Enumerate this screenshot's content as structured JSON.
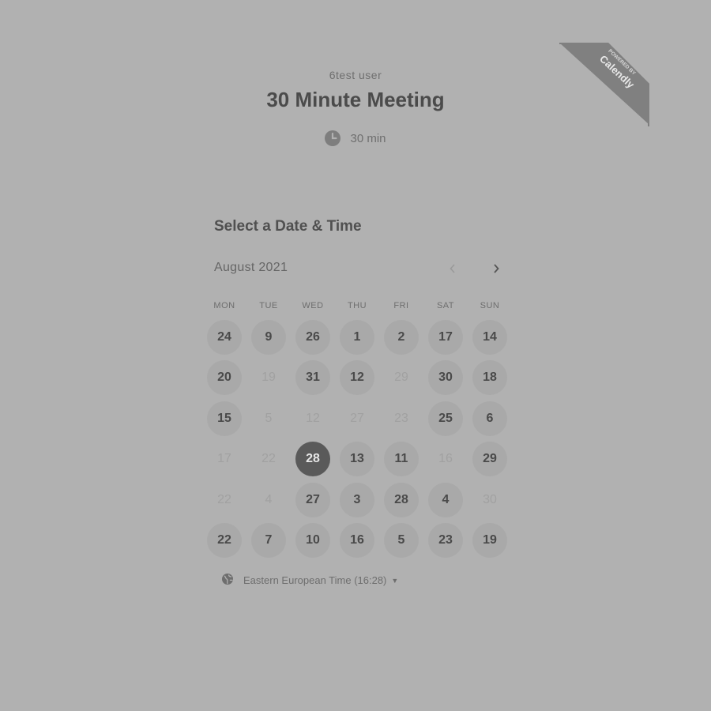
{
  "event": {
    "owner": "6test user",
    "title": "30 Minute Meeting",
    "duration": "30 min"
  },
  "badge": {
    "line1": "POWERED BY",
    "line2": "Calendly"
  },
  "calendar": {
    "heading": "Select a Date & Time",
    "month": "August 2021",
    "weekdays": [
      "MON",
      "TUE",
      "WED",
      "THU",
      "FRI",
      "SAT",
      "SUN"
    ],
    "days": [
      {
        "label": "24",
        "state": "available"
      },
      {
        "label": "9",
        "state": "available"
      },
      {
        "label": "26",
        "state": "available"
      },
      {
        "label": "1",
        "state": "available"
      },
      {
        "label": "2",
        "state": "available"
      },
      {
        "label": "17",
        "state": "available"
      },
      {
        "label": "14",
        "state": "available"
      },
      {
        "label": "20",
        "state": "available"
      },
      {
        "label": "19",
        "state": "unavailable"
      },
      {
        "label": "31",
        "state": "available"
      },
      {
        "label": "12",
        "state": "available"
      },
      {
        "label": "29",
        "state": "unavailable"
      },
      {
        "label": "30",
        "state": "available"
      },
      {
        "label": "18",
        "state": "available"
      },
      {
        "label": "15",
        "state": "available"
      },
      {
        "label": "5",
        "state": "unavailable"
      },
      {
        "label": "12",
        "state": "unavailable"
      },
      {
        "label": "27",
        "state": "unavailable"
      },
      {
        "label": "23",
        "state": "unavailable"
      },
      {
        "label": "25",
        "state": "available"
      },
      {
        "label": "6",
        "state": "available"
      },
      {
        "label": "17",
        "state": "unavailable"
      },
      {
        "label": "22",
        "state": "unavailable"
      },
      {
        "label": "28",
        "state": "selected"
      },
      {
        "label": "13",
        "state": "available"
      },
      {
        "label": "11",
        "state": "available"
      },
      {
        "label": "16",
        "state": "unavailable"
      },
      {
        "label": "29",
        "state": "available"
      },
      {
        "label": "22",
        "state": "unavailable"
      },
      {
        "label": "4",
        "state": "unavailable"
      },
      {
        "label": "27",
        "state": "available"
      },
      {
        "label": "3",
        "state": "available"
      },
      {
        "label": "28",
        "state": "available"
      },
      {
        "label": "4",
        "state": "available"
      },
      {
        "label": "30",
        "state": "unavailable"
      },
      {
        "label": "22",
        "state": "available"
      },
      {
        "label": "7",
        "state": "available"
      },
      {
        "label": "10",
        "state": "available"
      },
      {
        "label": "16",
        "state": "available"
      },
      {
        "label": "5",
        "state": "available"
      },
      {
        "label": "23",
        "state": "available"
      },
      {
        "label": "19",
        "state": "available"
      }
    ]
  },
  "timezone": {
    "label": "Eastern European Time (16:28)"
  },
  "colors": {
    "background": "#b1b1b1",
    "available_day": "#a9a9a9",
    "selected_day": "#5a5a5a",
    "badge": "#7e7e7e"
  }
}
